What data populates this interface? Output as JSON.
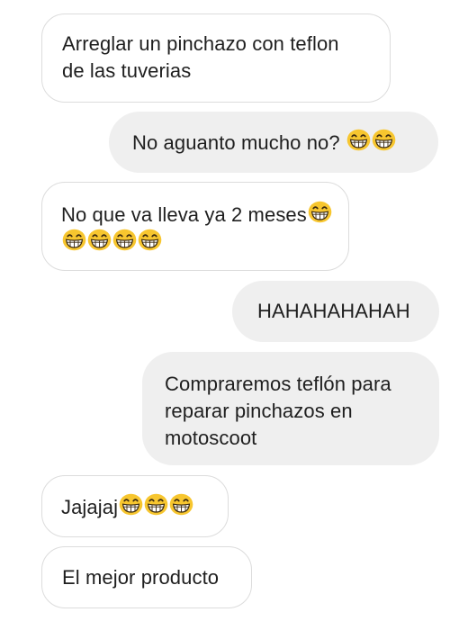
{
  "colors": {
    "incoming_bg": "#ffffff",
    "incoming_border": "#dcdcdc",
    "outgoing_bg": "#efefef",
    "text": "#1f1f1f",
    "emoji_face": "#f7c62f"
  },
  "emoji_icon": "grinning-face-with-smiling-eyes",
  "messages": [
    {
      "direction": "incoming",
      "lines": [
        "Arreglar un pinchazo con teflon",
        "de las tuverias"
      ]
    },
    {
      "direction": "outgoing",
      "text": "No aguanto mucho no?",
      "emoji_count": 2
    },
    {
      "direction": "incoming",
      "text": "No que va lleva ya 2 meses",
      "emoji_count": 5
    },
    {
      "direction": "outgoing",
      "text": "HAHAHAHAHAH"
    },
    {
      "direction": "outgoing",
      "lines": [
        "Compraremos teflón para",
        "reparar pinchazos en",
        "motoscoot"
      ]
    },
    {
      "direction": "incoming",
      "text": "Jajajaj",
      "emoji_count": 3
    },
    {
      "direction": "incoming",
      "text": "El mejor producto"
    }
  ]
}
